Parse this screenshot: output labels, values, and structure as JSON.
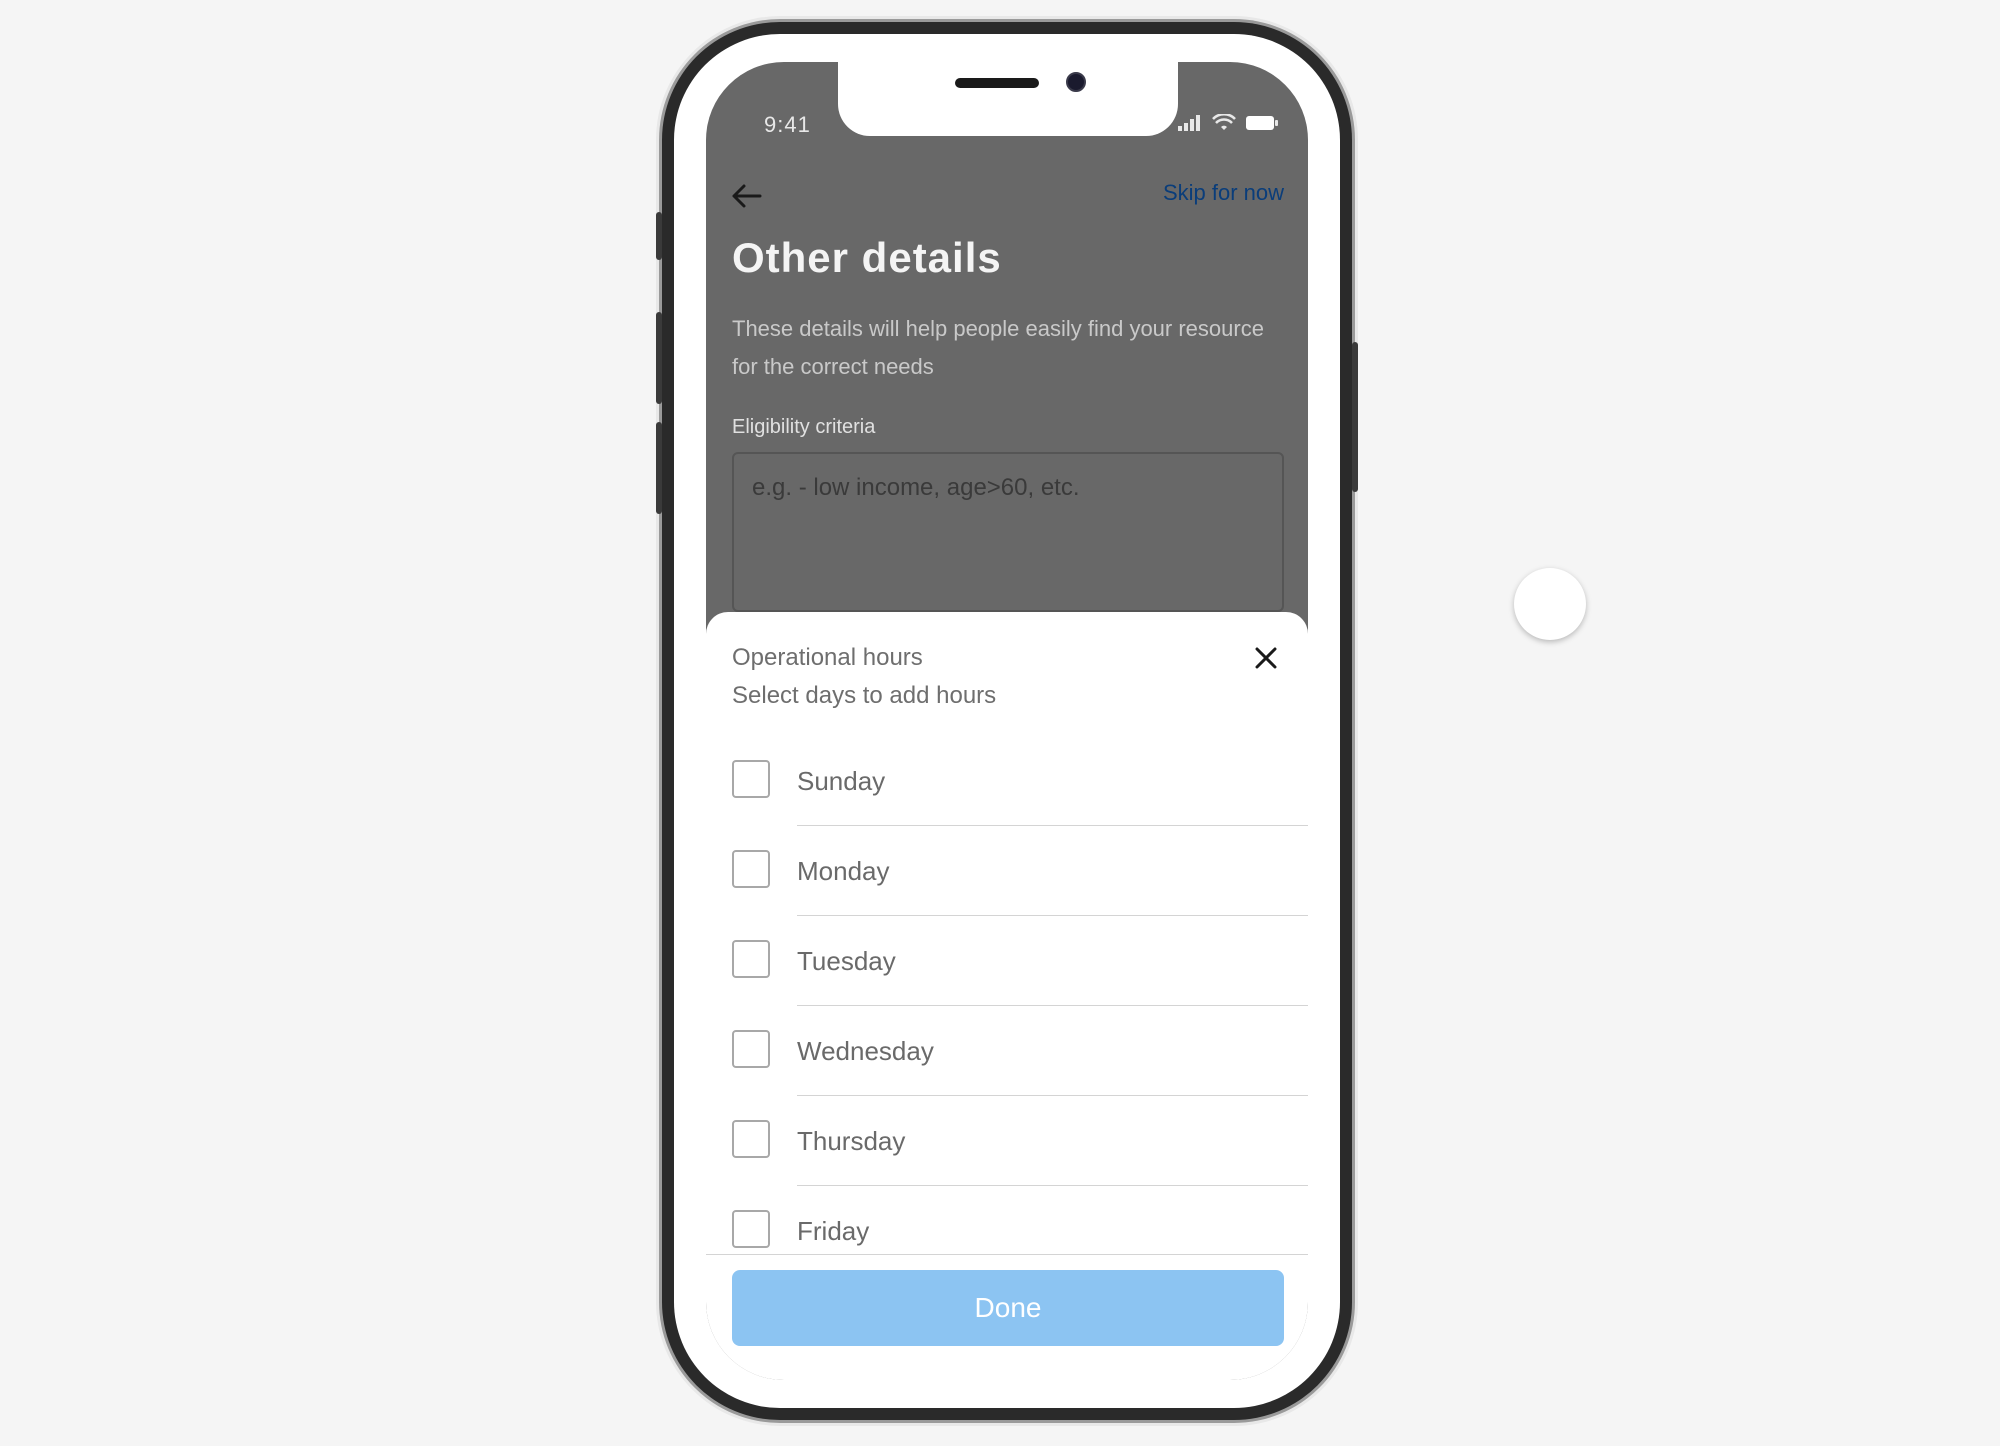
{
  "status_bar": {
    "time": "9:41"
  },
  "header": {
    "back_icon": "back-arrow-icon",
    "skip_label": "Skip for now",
    "title": "Other details",
    "description": "These details will help people easily find your resource for the correct needs"
  },
  "eligibility": {
    "label": "Eligibility criteria",
    "placeholder": "e.g. - low income, age>60, etc."
  },
  "sheet": {
    "title": "Operational hours",
    "subtitle": "Select days to add hours",
    "close_icon": "close-icon",
    "days": [
      {
        "label": "Sunday",
        "checked": false
      },
      {
        "label": "Monday",
        "checked": false
      },
      {
        "label": "Tuesday",
        "checked": false
      },
      {
        "label": "Wednesday",
        "checked": false
      },
      {
        "label": "Thursday",
        "checked": false
      },
      {
        "label": "Friday",
        "checked": false
      }
    ],
    "done_label": "Done"
  },
  "colors": {
    "overlay": "#686868",
    "link": "#0a3d7a",
    "done_button": "#8cc4f2"
  }
}
